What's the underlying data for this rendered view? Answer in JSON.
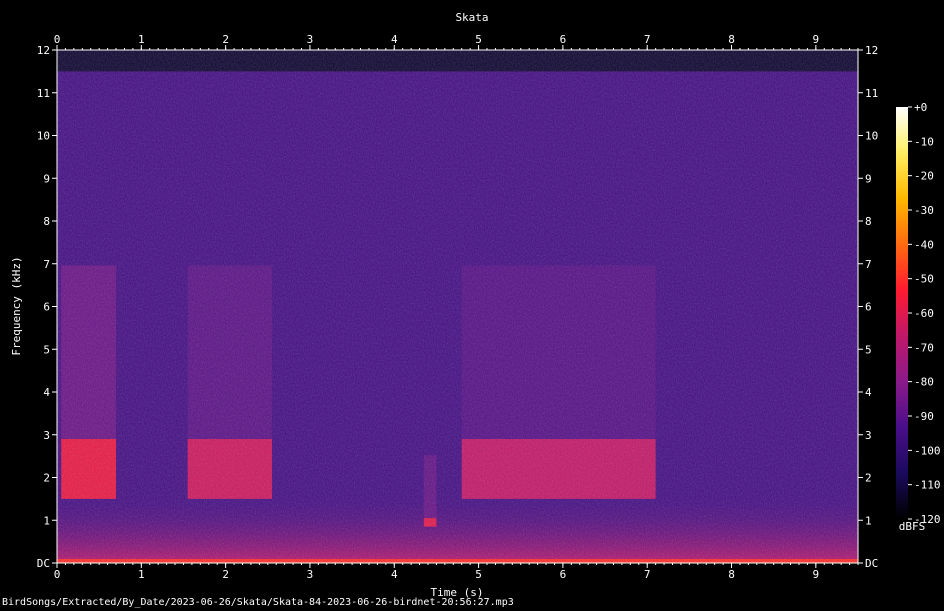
{
  "chart_data": {
    "type": "heatmap",
    "title": "Skata",
    "xlabel": "Time (s)",
    "ylabel": "Frequency (kHz)",
    "xlim": [
      0,
      9.5
    ],
    "ylim": [
      0,
      12
    ],
    "x_ticks": [
      0,
      1,
      2,
      3,
      4,
      5,
      6,
      7,
      8,
      9
    ],
    "y_ticks": [
      "DC",
      "1",
      "2",
      "3",
      "4",
      "5",
      "6",
      "7",
      "8",
      "9",
      "10",
      "11",
      "12"
    ],
    "colorbar": {
      "label": "dBFS",
      "range": [
        -120,
        0
      ],
      "ticks": [
        "+0",
        "-10",
        "-20",
        "-30",
        "-40",
        "-50",
        "-60",
        "-70",
        "-80",
        "-90",
        "-100",
        "-110",
        "-120"
      ],
      "colors": [
        "#000000",
        "#1a0a5c",
        "#4a0e8a",
        "#8a1a8a",
        "#c0186a",
        "#ff1a30",
        "#ff6a10",
        "#ffb800",
        "#ffee60",
        "#ffffff"
      ]
    },
    "grid": false,
    "noise_floor_dbfs": -95,
    "events": [
      {
        "t_start": 0.05,
        "t_end": 0.7,
        "f_low": 1.5,
        "f_high": 2.9,
        "level_dbfs": -58
      },
      {
        "t_start": 1.55,
        "t_end": 2.55,
        "f_low": 1.5,
        "f_high": 2.9,
        "level_dbfs": -64
      },
      {
        "t_start": 4.8,
        "t_end": 7.1,
        "f_low": 1.5,
        "f_high": 2.9,
        "level_dbfs": -66
      },
      {
        "t_start": 4.35,
        "t_end": 4.5,
        "f_low": 0.85,
        "f_high": 1.05,
        "level_dbfs": -60
      }
    ],
    "low_frequency_band": {
      "f_high": 1.0,
      "level_dbfs": -68
    },
    "dc_band_level_dbfs": -50
  },
  "footer": {
    "path": "BirdSongs/Extracted/By_Date/2023-06-26/Skata/Skata-84-2023-06-26-birdnet-20:56:27.mp3"
  }
}
